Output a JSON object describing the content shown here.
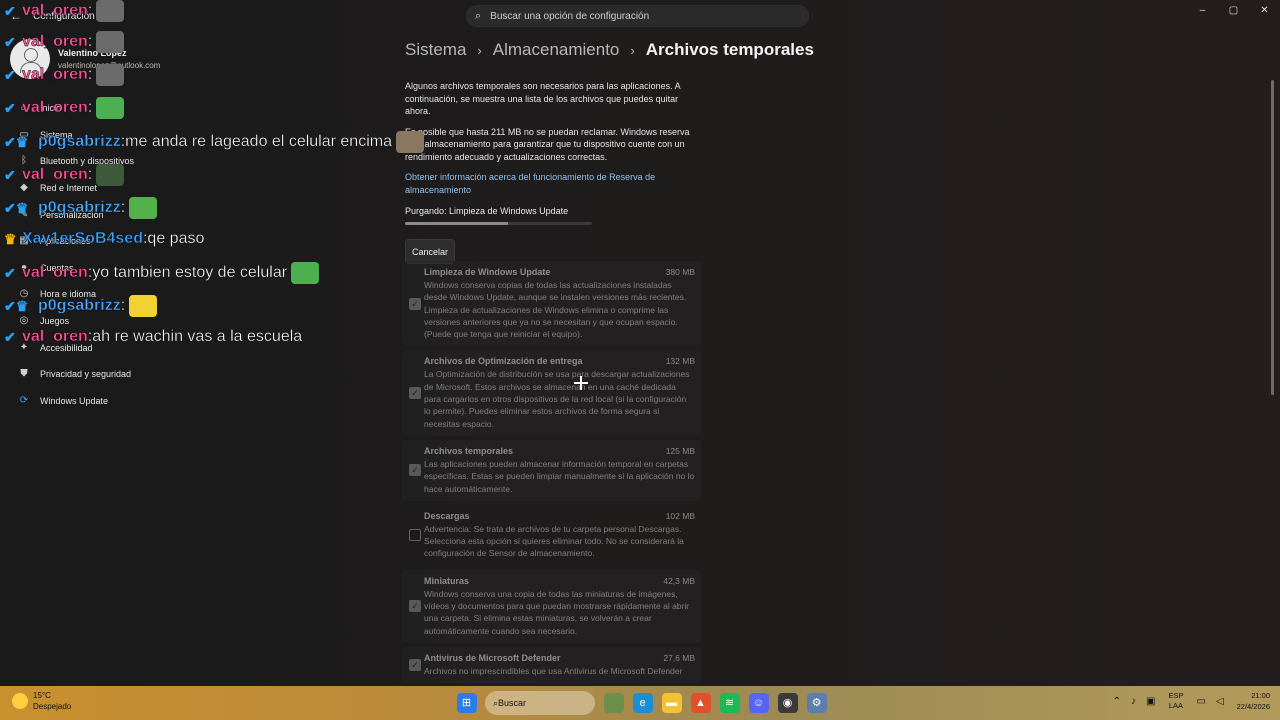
{
  "window": {
    "app_title": "Configuración",
    "search_placeholder": "Buscar una opción de configuración",
    "controls": {
      "minimize": "–",
      "maximize": "▢",
      "close": "✕"
    }
  },
  "user": {
    "name": "Valentino López",
    "email": "valentinolopez@outlook.com"
  },
  "nav": {
    "items": [
      {
        "label": "Inicio",
        "icon": "home-icon",
        "glyph": "⌂"
      },
      {
        "label": "Sistema",
        "icon": "monitor-icon",
        "glyph": "▭"
      },
      {
        "label": "Bluetooth y dispositivos",
        "icon": "bluetooth-icon",
        "glyph": "ᛒ"
      },
      {
        "label": "Red e Internet",
        "icon": "wifi-icon",
        "glyph": "◆"
      },
      {
        "label": "Personalización",
        "icon": "brush-icon",
        "glyph": "✎"
      },
      {
        "label": "Aplicaciones",
        "icon": "apps-icon",
        "glyph": "▦"
      },
      {
        "label": "Cuentas",
        "icon": "person-icon",
        "glyph": "●"
      },
      {
        "label": "Hora e idioma",
        "icon": "globe-clock-icon",
        "glyph": "◷"
      },
      {
        "label": "Juegos",
        "icon": "gamepad-icon",
        "glyph": "◎"
      },
      {
        "label": "Accesibilidad",
        "icon": "accessibility-icon",
        "glyph": "✦"
      },
      {
        "label": "Privacidad y seguridad",
        "icon": "shield-icon",
        "glyph": "⛊"
      },
      {
        "label": "Windows Update",
        "icon": "update-icon",
        "glyph": "⟳"
      }
    ]
  },
  "breadcrumb": {
    "level1": "Sistema",
    "level2": "Almacenamiento",
    "current": "Archivos temporales",
    "separator": "›"
  },
  "content": {
    "intro": "Algunos archivos temporales son necesarios para las aplicaciones. A continuación, se muestra una lista de los archivos que puedes quitar ahora.",
    "reserve": "Es posible que hasta 211 MB no se puedan reclamar. Windows reserva este almacenamiento para garantizar que tu dispositivo cuente con un rendimiento adecuado y actualizaciones correctas.",
    "link": "Obtener información acerca del funcionamiento de Reserva de almacenamiento",
    "purging": "Purgando: Limpieza de Windows Update",
    "progress": 0.55,
    "cancel": "Cancelar"
  },
  "cards": [
    {
      "title": "Limpieza de Windows Update",
      "size": "380 MB",
      "checked": true,
      "desc": "Windows conserva copias de todas las actualizaciones instaladas desde Windows Update, aunque se instalen versiones más recientes. Limpieza de actualizaciones de Windows elimina o comprime las versiones anteriores que ya no se necesitan y que ocupan espacio. (Puede que tenga que reiniciar el equipo)."
    },
    {
      "title": "Archivos de Optimización de entrega",
      "size": "132 MB",
      "checked": true,
      "desc": "La Optimización de distribución se usa para descargar actualizaciones de Microsoft. Estos archivos se almacenan en una caché dedicada para cargarlos en otros dispositivos de la red local (si la configuración lo permite). Puedes eliminar estos archivos de forma segura si necesitas espacio."
    },
    {
      "title": "Archivos temporales",
      "size": "125 MB",
      "checked": true,
      "desc": "Las aplicaciones pueden almacenar información temporal en carpetas específicas. Estas se pueden limpiar manualmente si la aplicación no lo hace automáticamente."
    },
    {
      "title": "Descargas",
      "size": "102 MB",
      "checked": false,
      "desc": "Advertencia: Se trata de archivos de tu carpeta personal Descargas. Selecciona esta opción si quieres eliminar todo. No se considerará la configuración de Sensor de almacenamiento."
    },
    {
      "title": "Miniaturas",
      "size": "42,3 MB",
      "checked": true,
      "desc": "Windows conserva una copia de todas las miniaturas de imágenes, vídeos y documentos para que puedan mostrarse rápidamente al abrir una carpeta. Si elimina estas miniaturas, se volverán a crear automáticamente cuando sea necesario."
    },
    {
      "title": "Antivirus de Microsoft Defender",
      "size": "27,6 MB",
      "checked": true,
      "desc": "Archivos no imprescindibles que usa Antivirus de Microsoft Defender"
    }
  ],
  "chat": [
    {
      "badge": "✔",
      "user": "val_oren",
      "color": "#ff4f9a",
      "text": "",
      "emote": "#6b6b6b"
    },
    {
      "badge": "✔",
      "user": "val_oren",
      "color": "#ff4f9a",
      "text": "",
      "emote": "#6b6b6b"
    },
    {
      "badge": "✔",
      "user": "val_oren",
      "color": "#ff4f9a",
      "text": "",
      "emote": "#6b6b6b"
    },
    {
      "badge": "✔",
      "user": "val_oren",
      "color": "#ff4f9a",
      "text": "",
      "emote": "#4caf50"
    },
    {
      "badge": "✔♛",
      "user": "p0gsabrizz",
      "color": "#4aa8ff",
      "text": "me anda re lageado el celular encima",
      "emote": "#8a7760"
    },
    {
      "badge": "✔",
      "user": "val_oren",
      "color": "#ff4f9a",
      "text": "",
      "emote": "#3f5a3a"
    },
    {
      "badge": "✔♛",
      "user": "p0gsabrizz",
      "color": "#4aa8ff",
      "text": "",
      "emote": "#54b04a"
    },
    {
      "badge": "♛",
      "user": "Xav1erSoB4sed",
      "color": "#3aa0ff",
      "text": "qe paso",
      "emote": ""
    },
    {
      "badge": "✔",
      "user": "val_oren",
      "color": "#ff4f9a",
      "text": "yo tambien estoy de celular",
      "emote": "#4caf50"
    },
    {
      "badge": "✔♛",
      "user": "p0gsabrizz",
      "color": "#4aa8ff",
      "text": "",
      "emote": "#f2d233"
    },
    {
      "badge": "✔",
      "user": "val_oren",
      "color": "#ff4f9a",
      "text": "ah re wachin vas a la escuela",
      "emote": ""
    }
  ],
  "taskbar": {
    "weather_temp": "15°C",
    "weather_desc": "Despejado",
    "search_label": "Buscar",
    "lang_line1": "ESP",
    "lang_line2": "LAA",
    "time": "21:00",
    "date": "22/4/2026",
    "apps": [
      {
        "name": "start-icon",
        "glyph": "⊞",
        "color": "#2b7de9"
      },
      {
        "name": "frog-app-icon",
        "glyph": "",
        "color": "#6c8f4e"
      },
      {
        "name": "edge-icon",
        "glyph": "e",
        "color": "#1b8fd6"
      },
      {
        "name": "file-explorer-icon",
        "glyph": "▬",
        "color": "#f2c230"
      },
      {
        "name": "brave-icon",
        "glyph": "▲",
        "color": "#e0502a"
      },
      {
        "name": "spotify-icon",
        "glyph": "≋",
        "color": "#1db954"
      },
      {
        "name": "discord-icon",
        "glyph": "☺",
        "color": "#5865f2"
      },
      {
        "name": "obs-icon",
        "glyph": "◉",
        "color": "#3a3a3a"
      },
      {
        "name": "settings-icon",
        "glyph": "⚙",
        "color": "#5a7fae"
      }
    ]
  }
}
